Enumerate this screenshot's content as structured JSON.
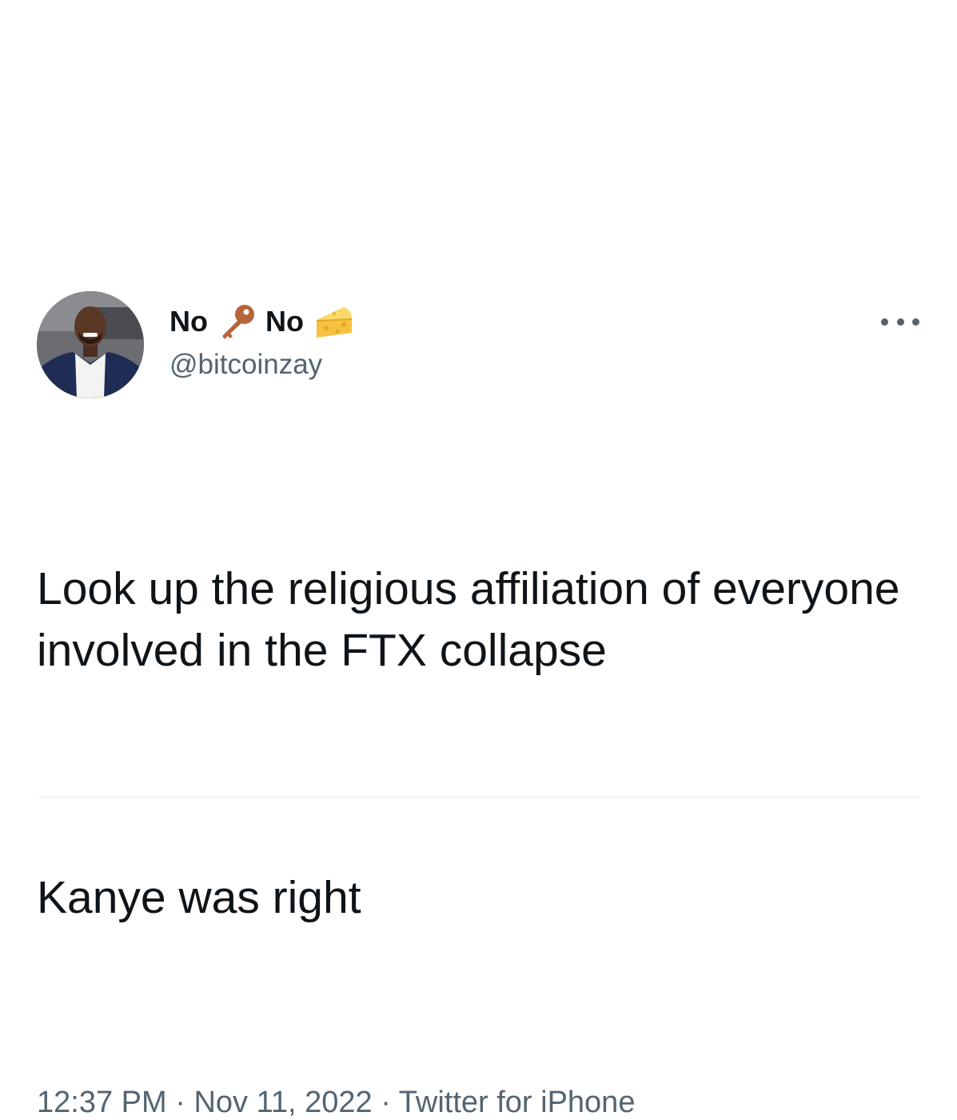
{
  "tweet": {
    "author": {
      "name_part1": "No",
      "name_emoji1": "key-icon",
      "name_part2": "No",
      "name_emoji2": "cheese-icon",
      "handle": "@bitcoinzay",
      "avatar": "avatar-photo"
    },
    "more_icon": "more-options-icon",
    "text_line1": "Look up the religious affiliation of everyone involved in the FTX collapse",
    "text_line2": "Kanye was right",
    "time": "12:37 PM",
    "sep1": "·",
    "date": "Nov 11, 2022",
    "sep2": "·",
    "source": "Twitter for iPhone"
  },
  "colors": {
    "text": "#0f1419",
    "secondary": "#536471",
    "divider": "#eff3f4"
  }
}
